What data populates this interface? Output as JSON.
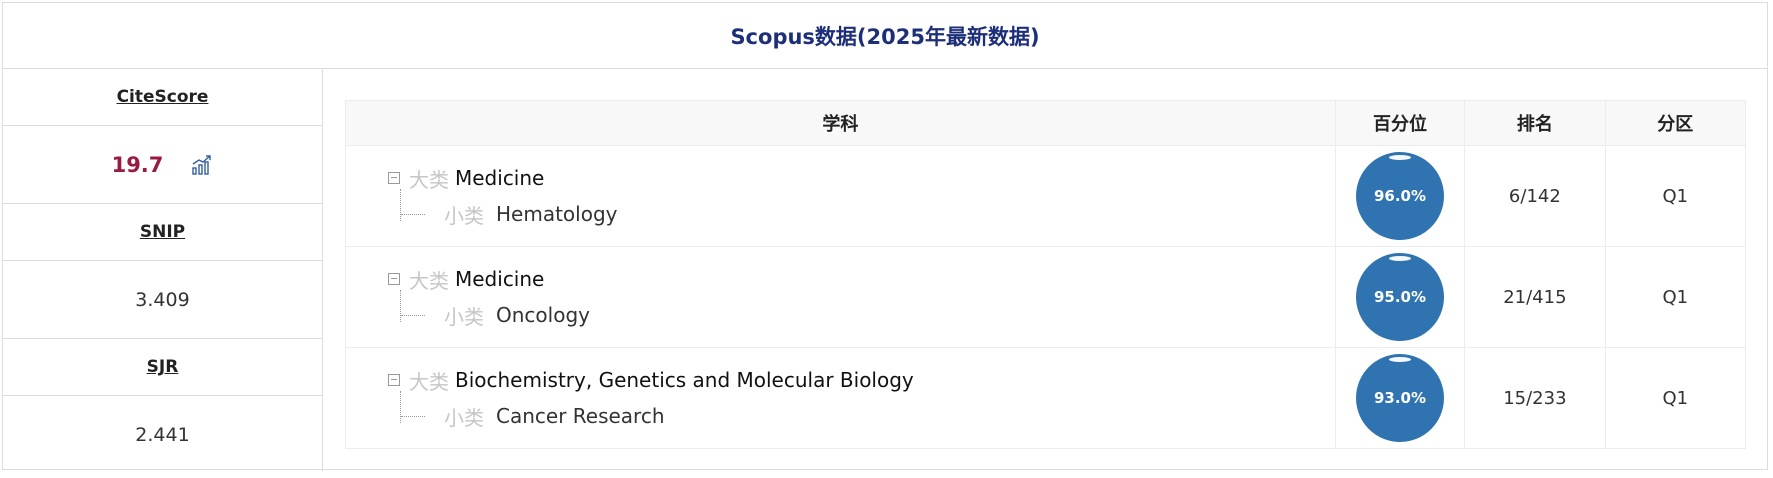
{
  "title": "Scopus数据(2025年最新数据)",
  "metrics": {
    "citescore": {
      "label": "CiteScore",
      "value": "19.7",
      "icon": "trend-chart-icon"
    },
    "snip": {
      "label": "SNIP",
      "value": "3.409"
    },
    "sjr": {
      "label": "SJR",
      "value": "2.441"
    }
  },
  "table": {
    "headers": [
      "学科",
      "百分位",
      "排名",
      "分区"
    ],
    "rows": [
      {
        "big_tag": "大类",
        "big": "Medicine",
        "small_tag": "小类",
        "small": "Hematology",
        "percentile": "96.0%",
        "rank": "6/142",
        "quartile": "Q1"
      },
      {
        "big_tag": "大类",
        "big": "Medicine",
        "small_tag": "小类",
        "small": "Oncology",
        "percentile": "95.0%",
        "rank": "21/415",
        "quartile": "Q1"
      },
      {
        "big_tag": "大类",
        "big": "Biochemistry, Genetics and Molecular Biology",
        "small_tag": "小类",
        "small": "Cancer Research",
        "percentile": "93.0%",
        "rank": "15/233",
        "quartile": "Q1"
      }
    ]
  },
  "colors": {
    "title": "#1e2f7a",
    "citescore": "#9a1b3f",
    "bubble": "#2f74b0"
  }
}
